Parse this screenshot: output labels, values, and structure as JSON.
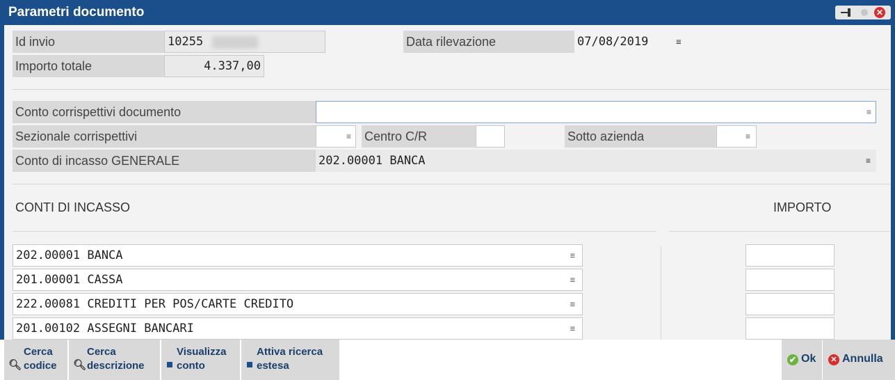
{
  "window": {
    "title": "Parametri documento"
  },
  "header": {
    "id_invio_label": "Id invio",
    "id_invio_value": "10255",
    "data_rilevazione_label": "Data rilevazione",
    "data_rilevazione_value": "07/08/2019",
    "importo_totale_label": "Importo totale",
    "importo_totale_value": "4.337,00"
  },
  "form": {
    "conto_corrispettivi_label": "Conto corrispettivi documento",
    "conto_corrispettivi_value": "",
    "sezionale_label": "Sezionale corrispettivi",
    "centro_label": "Centro C/R",
    "sotto_azienda_label": "Sotto azienda",
    "conto_incasso_generale_label": "Conto di incasso GENERALE",
    "conto_incasso_generale_value": "202.00001 BANCA"
  },
  "table": {
    "col_conti": "CONTI DI INCASSO",
    "col_importo": "IMPORTO",
    "rows": [
      {
        "conto": "202.00001 BANCA",
        "importo": ""
      },
      {
        "conto": "201.00001 CASSA",
        "importo": ""
      },
      {
        "conto": "222.00081 CREDITI PER POS/CARTE CREDITO",
        "importo": ""
      },
      {
        "conto": "201.00102 ASSEGNI BANCARI",
        "importo": ""
      }
    ]
  },
  "footer": {
    "cerca_codice": [
      "Cerca",
      "codice"
    ],
    "cerca_descrizione": [
      "Cerca",
      "descrizione"
    ],
    "visualizza_conto": [
      "Visualizza",
      "conto"
    ],
    "attiva_ricerca": [
      "Attiva ricerca",
      "estesa"
    ],
    "ok": "Ok",
    "annulla": "Annulla"
  },
  "icons": {
    "menu": "≡",
    "search": "magnifier-icon",
    "close": "close-icon",
    "pin": "pin-icon"
  },
  "colors": {
    "titlebar": "#1a4f8b",
    "label_bg": "#d9d9d9",
    "ok_green": "#6cb33f",
    "cancel_red": "#d62f2f"
  }
}
